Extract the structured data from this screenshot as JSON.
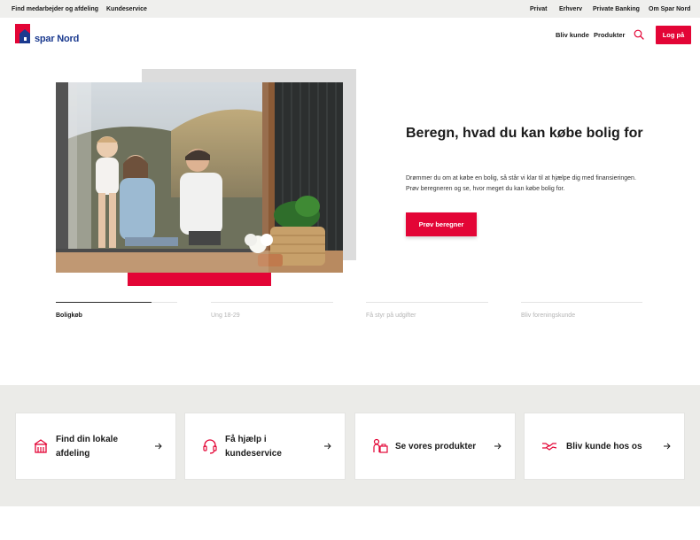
{
  "utility_bar": {
    "left_links": [
      "Find medarbejder og afdeling",
      "Kundeservice"
    ],
    "right_links": [
      "Privat",
      "Erhverv",
      "Private Banking",
      "Om Spar Nord"
    ]
  },
  "header": {
    "logo_text": "spar Nord",
    "nav": [
      "Bliv kunde",
      "Produkter"
    ],
    "login_label": "Log på"
  },
  "colors": {
    "brand_red": "#e30536",
    "brand_blue": "#1b3a8f"
  },
  "hero": {
    "title": "Beregn, hvad du kan købe bolig for",
    "text": "Drømmer du om at købe en bolig, så står vi klar til at hjælpe dig med finansieringen. Prøv beregneren og se, hvor meget du kan købe bolig for.",
    "cta_label": "Prøv beregner"
  },
  "tabs": [
    {
      "label": "Boligkøb",
      "active": true
    },
    {
      "label": "Ung 18-29",
      "active": false
    },
    {
      "label": "Få styr på udgifter",
      "active": false
    },
    {
      "label": "Bliv foreningskunde",
      "active": false
    }
  ],
  "cards": [
    {
      "label": "Find din lokale afdeling",
      "icon": "branch-icon"
    },
    {
      "label": "Få hjælp i kundeservice",
      "icon": "headset-icon"
    },
    {
      "label": "Se vores produkter",
      "icon": "products-icon"
    },
    {
      "label": "Bliv kunde hos os",
      "icon": "handshake-icon"
    }
  ]
}
